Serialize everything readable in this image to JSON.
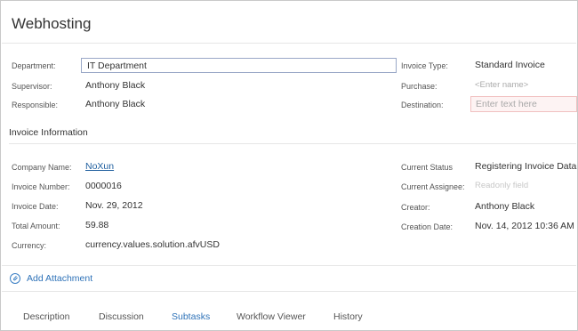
{
  "header": {
    "title": "Webhosting"
  },
  "form": {
    "department_label": "Department:",
    "department_value": "IT Department",
    "supervisor_label": "Supervisor:",
    "supervisor_value": "Anthony Black",
    "responsible_label": "Responsible:",
    "responsible_value": "Anthony Black",
    "invoice_type_label": "Invoice Type:",
    "invoice_type_value": "Standard Invoice",
    "purchase_label": "Purchase:",
    "purchase_placeholder": "<Enter name>",
    "destination_label": "Destination:",
    "destination_placeholder": "Enter text here"
  },
  "invoice": {
    "section_title": "Invoice Information",
    "company_label": "Company Name:",
    "company_value": "NoXun",
    "number_label": "Invoice Number:",
    "number_value": "0000016",
    "date_label": "Invoice Date:",
    "date_value": "Nov. 29, 2012",
    "total_label": "Total Amount:",
    "total_value": "59.88",
    "currency_label": "Currency:",
    "currency_value": "currency.values.solution.afvUSD",
    "status_label": "Current Status",
    "status_value": "Registering Invoice Data",
    "assignee_label": "Current Assignee:",
    "assignee_value": "Readonly field",
    "creator_label": "Creator:",
    "creator_value": "Anthony Black",
    "creation_date_label": "Creation Date:",
    "creation_date_value": "Nov. 14, 2012 10:36 AM"
  },
  "attachment": {
    "label": "Add Attachment",
    "icon": "paperclip-icon"
  },
  "tabs": [
    {
      "label": "Description"
    },
    {
      "label": "Discussion"
    },
    {
      "label": "Subtasks",
      "active": true
    },
    {
      "label": "Workflow Viewer"
    },
    {
      "label": "History"
    }
  ],
  "colors": {
    "accent": "#2e72b8",
    "input_border": "#9aa8c7",
    "error_bg": "#fdf3f3",
    "error_border": "#f1c1c1"
  }
}
